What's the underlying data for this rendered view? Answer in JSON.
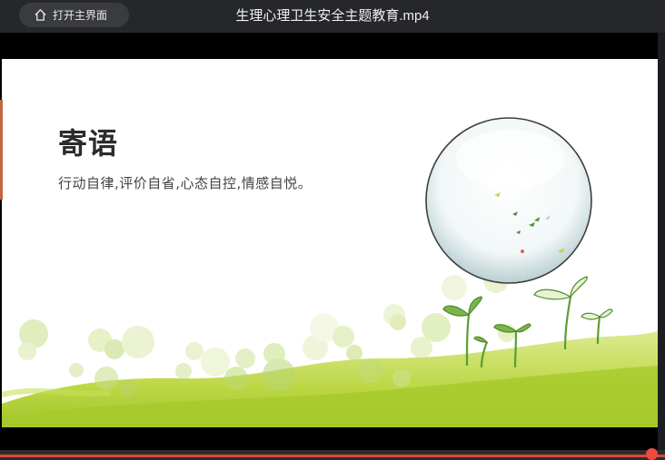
{
  "titlebar": {
    "home_button_label": "打开主界面",
    "title": "生理心理卫生安全主题教育.mp4"
  },
  "slide": {
    "heading": "寄语",
    "line": "行动自律,评价自省,心态自控,情感自悦。"
  },
  "player": {
    "progress_fraction": 0.98,
    "accent_color": "#ef4a3b"
  },
  "icons": {
    "home": "home-icon"
  }
}
